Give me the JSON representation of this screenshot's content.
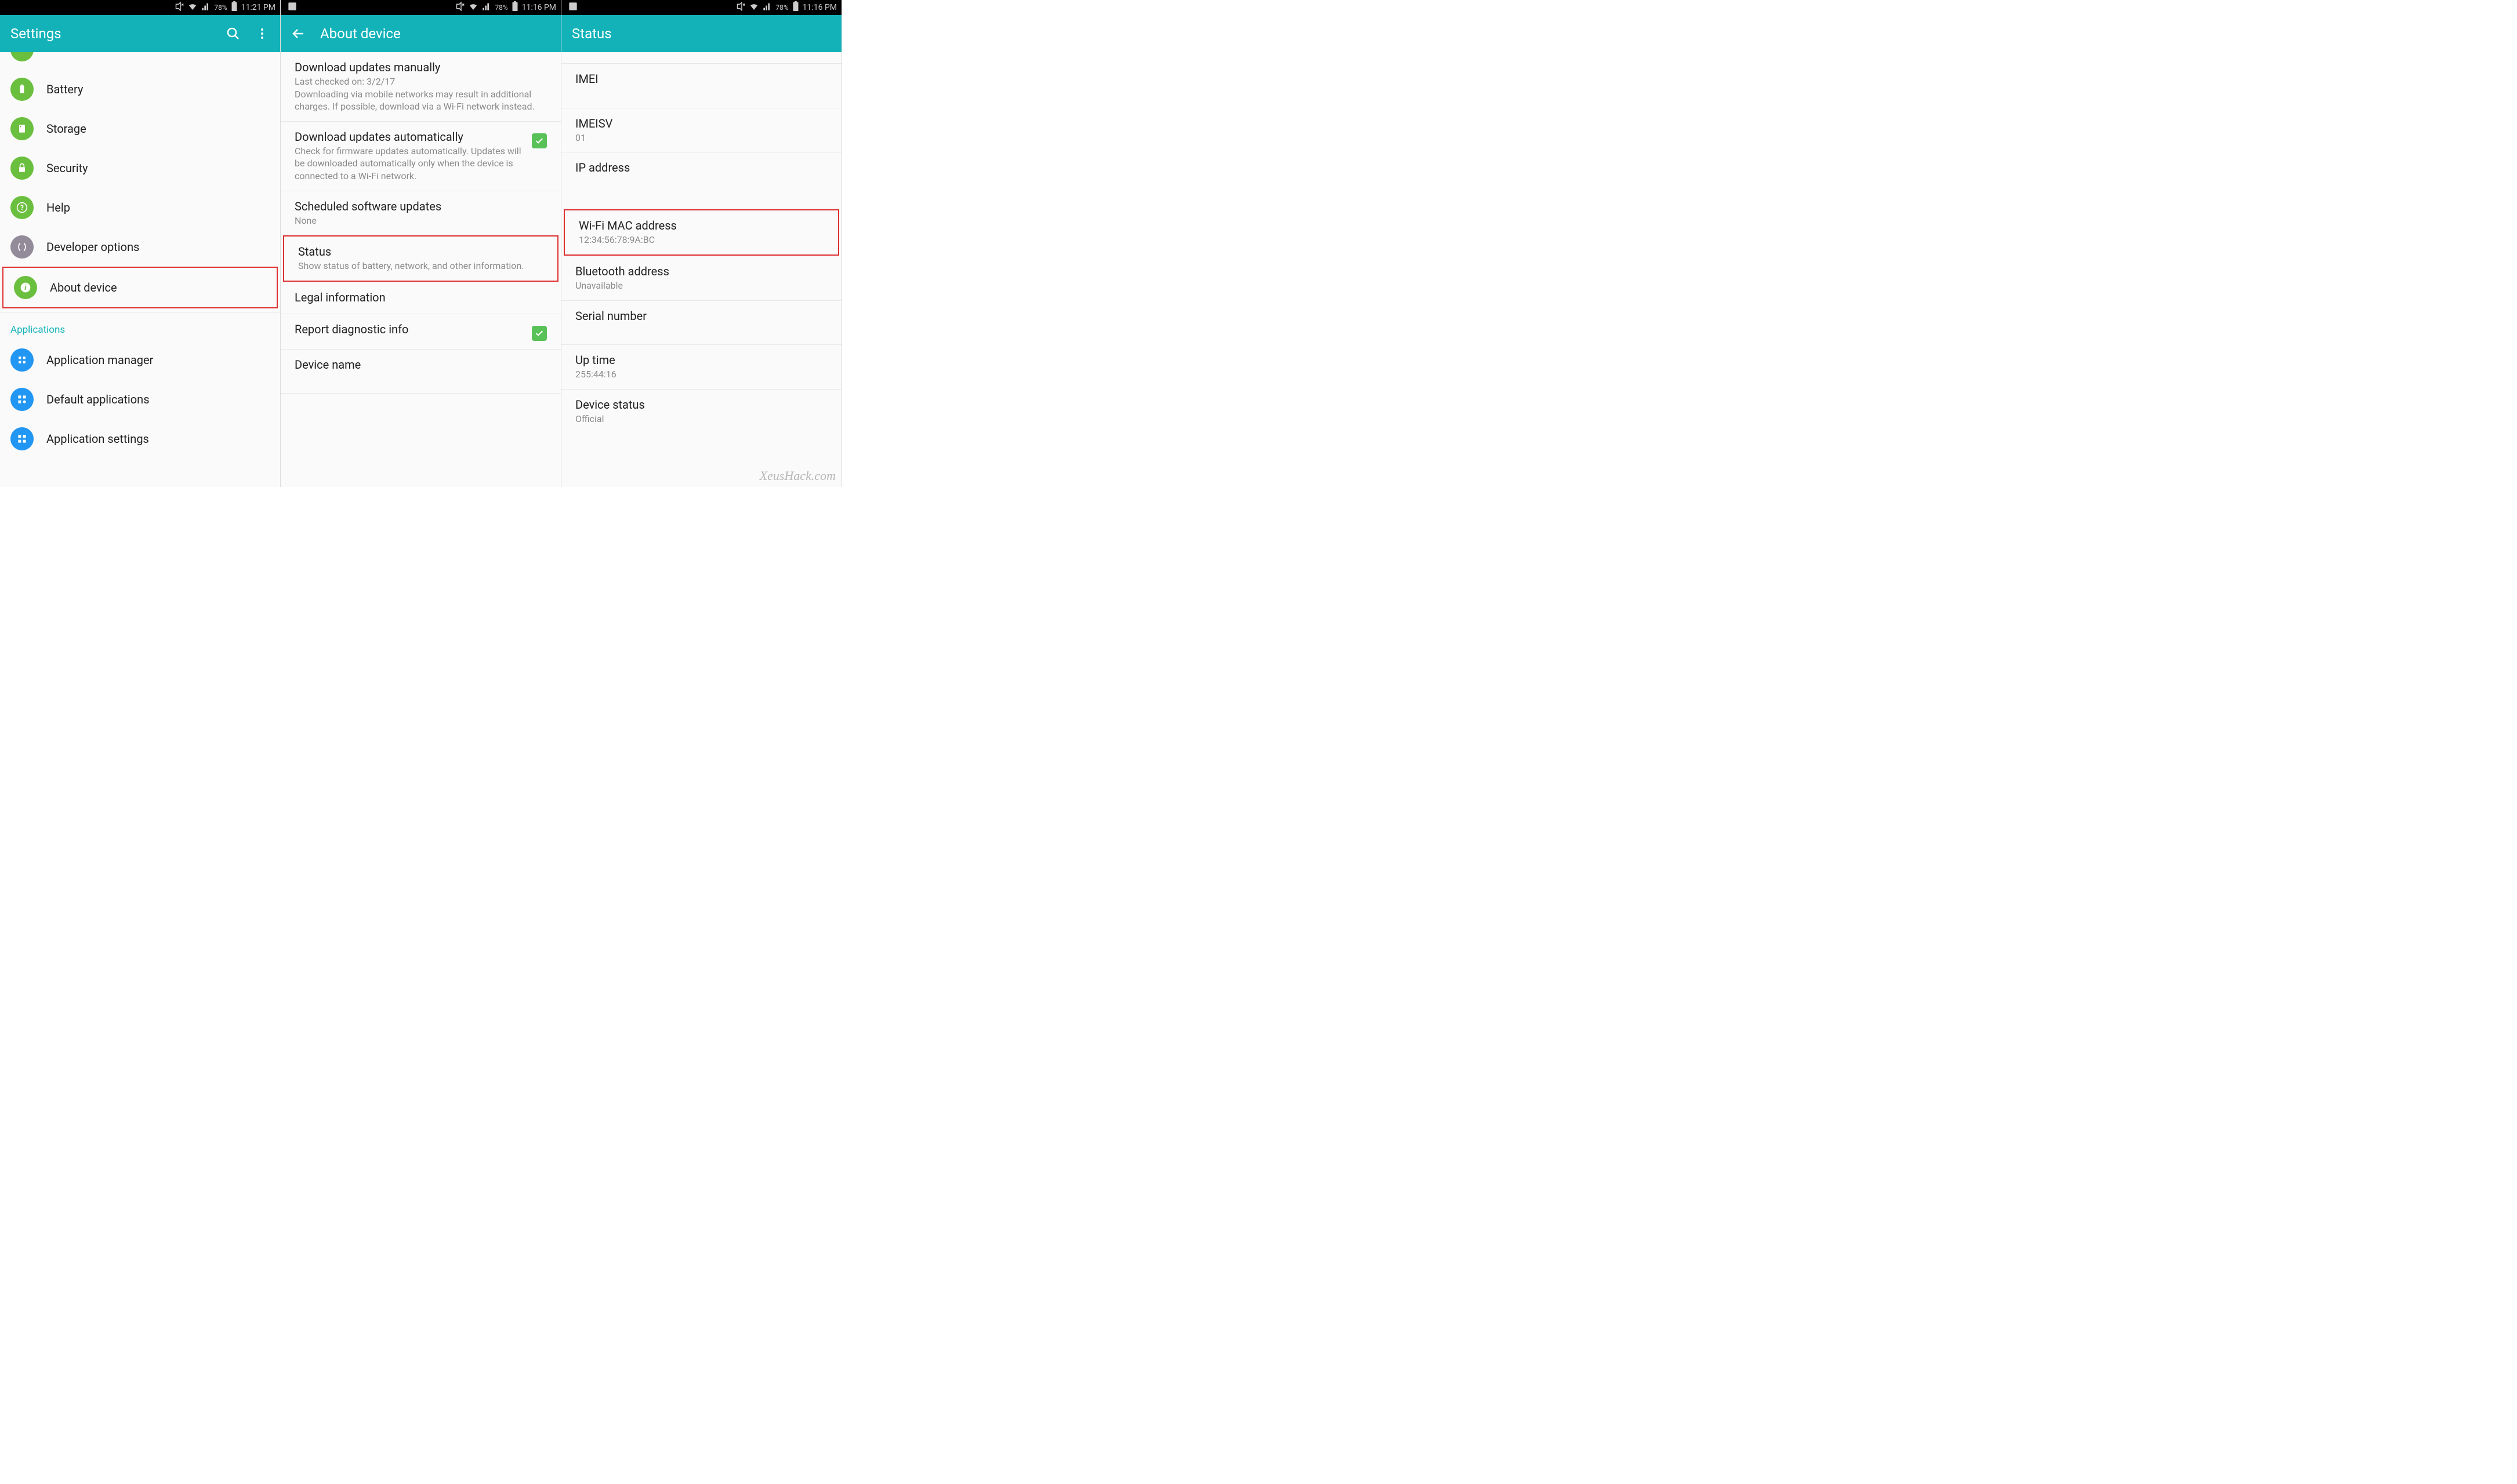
{
  "status": {
    "battery": "78%",
    "time1": "11:21 PM",
    "time23": "11:16 PM"
  },
  "screen1": {
    "title": "Settings",
    "items": {
      "battery": "Battery",
      "storage": "Storage",
      "security": "Security",
      "help": "Help",
      "developer": "Developer options",
      "about": "About device"
    },
    "applications_header": "Applications",
    "apps": {
      "manager": "Application manager",
      "default": "Default applications",
      "settings": "Application settings"
    }
  },
  "screen2": {
    "title": "About device",
    "download_manual": {
      "title": "Download updates manually",
      "sub": "Last checked on: 3/2/17\nDownloading via mobile networks may result in additional charges. If possible, download via a Wi-Fi network instead."
    },
    "download_auto": {
      "title": "Download updates automatically",
      "sub": "Check for firmware updates automatically. Updates will be downloaded automatically only when the device is connected to a Wi-Fi network."
    },
    "scheduled": {
      "title": "Scheduled software updates",
      "sub": "None"
    },
    "status": {
      "title": "Status",
      "sub": "Show status of battery, network, and other information."
    },
    "legal": {
      "title": "Legal information"
    },
    "report": {
      "title": "Report diagnostic info"
    },
    "devname": {
      "title": "Device name"
    }
  },
  "screen3": {
    "title": "Status",
    "imei": {
      "title": "IMEI"
    },
    "imeisv": {
      "title": "IMEISV",
      "sub": "01"
    },
    "ip": {
      "title": "IP address"
    },
    "wifimac": {
      "title": "Wi-Fi MAC address",
      "sub": "12:34:56:78:9A:BC"
    },
    "bt": {
      "title": "Bluetooth address",
      "sub": "Unavailable"
    },
    "serial": {
      "title": "Serial number"
    },
    "uptime": {
      "title": "Up time",
      "sub": "255:44:16"
    },
    "devstatus": {
      "title": "Device status",
      "sub": "Official"
    }
  },
  "watermark": "XeusHack.com"
}
